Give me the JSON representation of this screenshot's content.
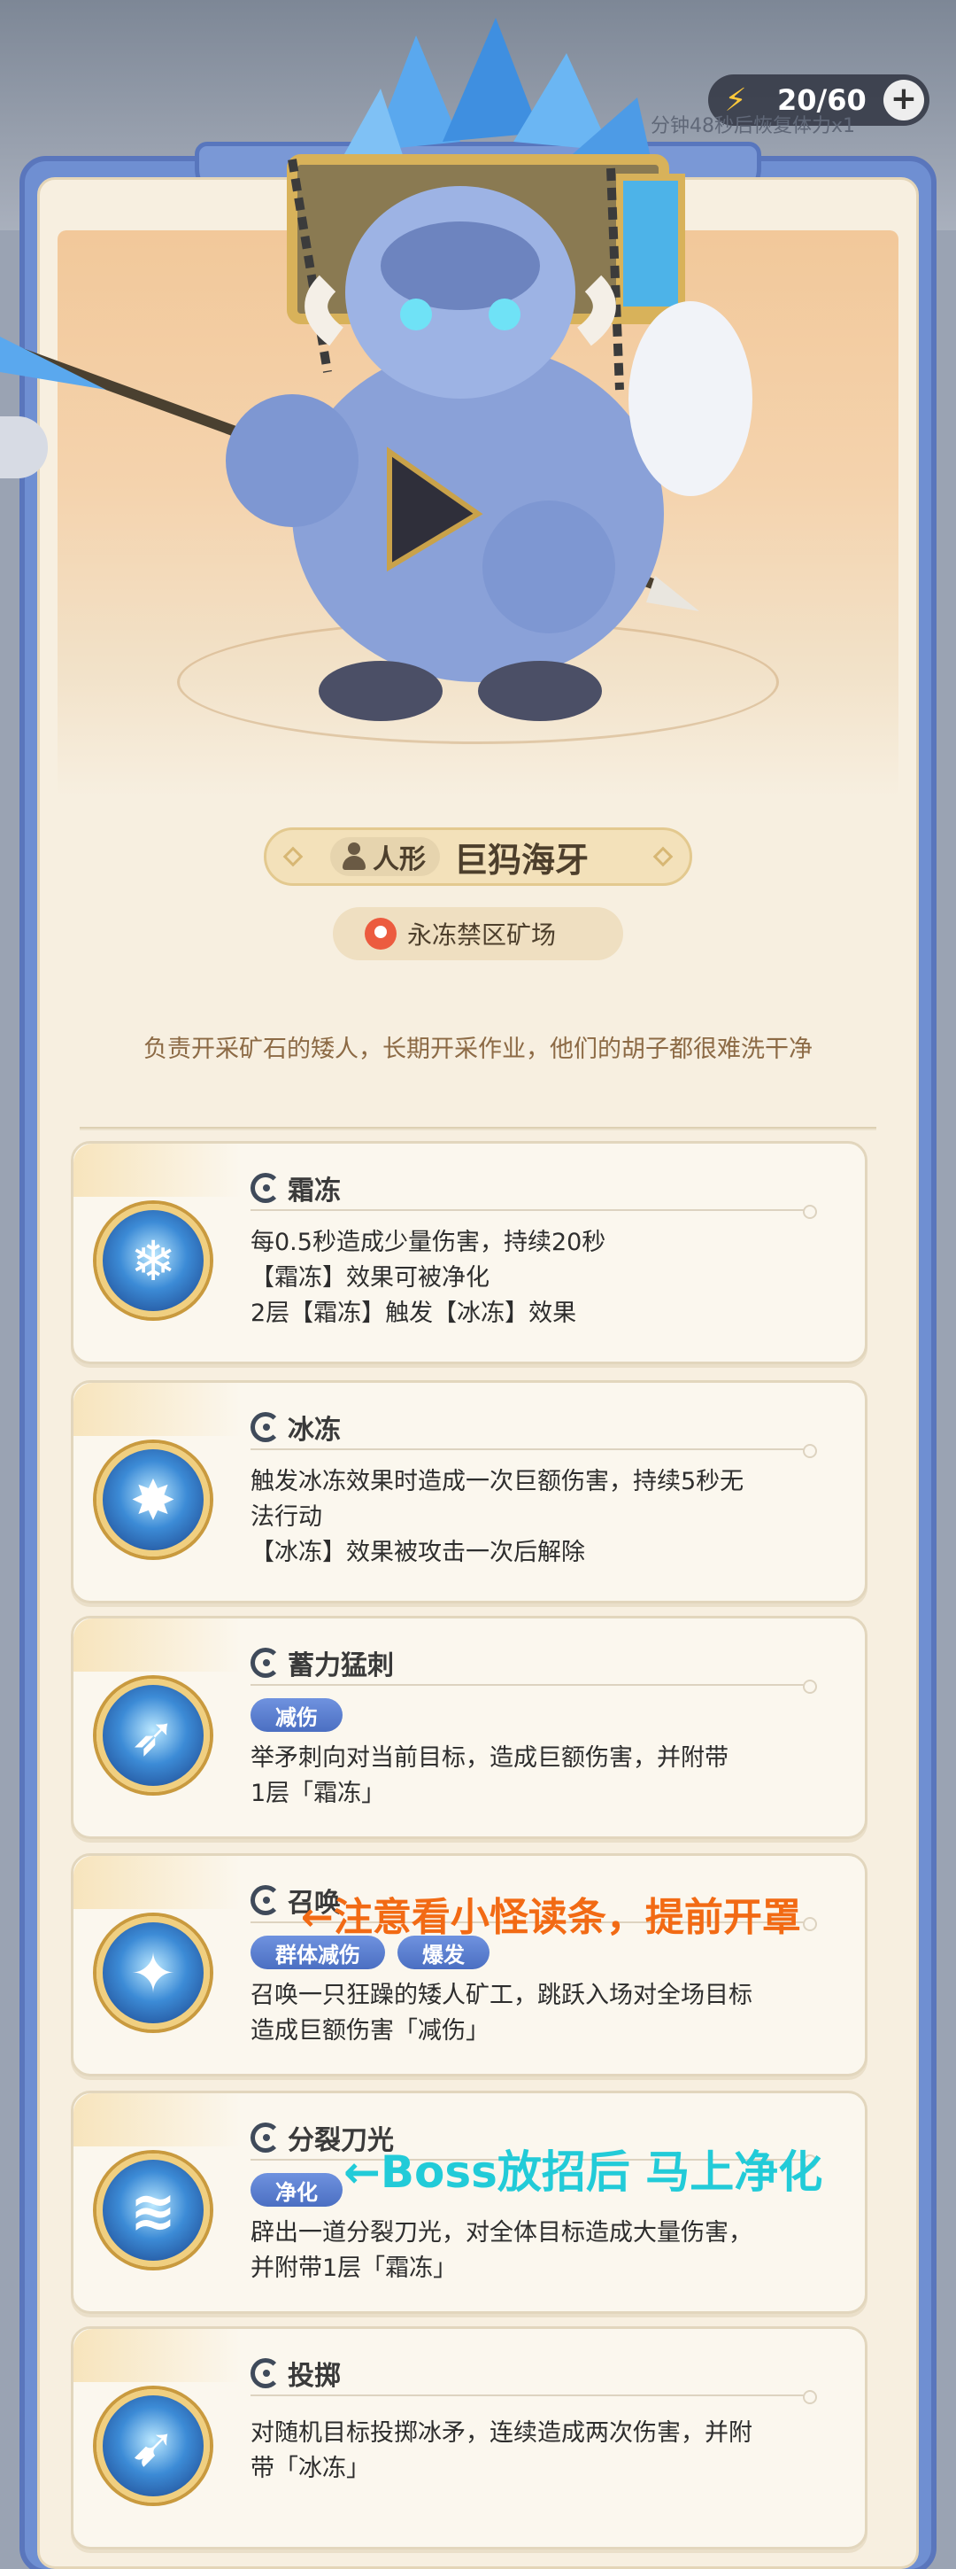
{
  "stamina": {
    "value": "20/60",
    "recover_text": "分钟48秒后恢复体力x1",
    "bolt_icon": "lightning-icon",
    "add_icon": "plus-icon"
  },
  "boss": {
    "type_label": "人形",
    "name": "巨犸海牙",
    "location": "永冻禁区矿场",
    "description": "负责开采矿石的矮人，长期开采作业，他们的胡子都很难洗干净"
  },
  "skills": [
    {
      "name": "霜冻",
      "icon": "snowflake-icon",
      "tags": [],
      "lines": [
        "每0.5秒造成少量伤害，持续20秒",
        "【霜冻】效果可被净化",
        "2层【霜冻】触发【冰冻】效果"
      ]
    },
    {
      "name": "冰冻",
      "icon": "ice-burst-icon",
      "tags": [],
      "lines": [
        "触发冰冻效果时造成一次巨额伤害，持续5秒无",
        "法行动",
        "【冰冻】效果被攻击一次后解除"
      ]
    },
    {
      "name": "蓄力猛刺",
      "icon": "spear-thrust-icon",
      "tags": [
        "减伤"
      ],
      "lines": [
        "举矛刺向对当前目标，造成巨额伤害，并附带",
        "1层「霜冻」"
      ]
    },
    {
      "name": "召唤",
      "icon": "summon-icon",
      "tags": [
        "群体减伤",
        "爆发"
      ],
      "lines": [
        "召唤一只狂躁的矮人矿工，跳跃入场对全场目标",
        "造成巨额伤害「减伤」"
      ]
    },
    {
      "name": "分裂刀光",
      "icon": "split-blade-icon",
      "tags": [
        "净化"
      ],
      "lines": [
        "辟出一道分裂刀光，对全体目标造成大量伤害，",
        "并附带1层「霜冻」"
      ]
    },
    {
      "name": "投掷",
      "icon": "throw-spear-icon",
      "tags": [],
      "lines": [
        "对随机目标投掷冰矛，连续造成两次伤害，并附",
        "带「冰冻」"
      ]
    }
  ],
  "annotations": {
    "summon_note": "←注意看小怪读条，提前开罩",
    "split_note": "←Boss放招后 马上净化"
  }
}
